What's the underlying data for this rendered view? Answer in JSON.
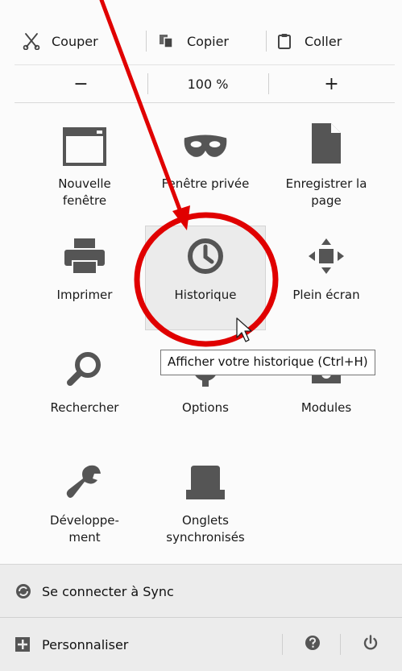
{
  "edit": {
    "cut_label": "Couper",
    "copy_label": "Copier",
    "paste_label": "Coller"
  },
  "zoom": {
    "minus": "−",
    "level": "100 %",
    "plus": "+"
  },
  "tiles": {
    "new_window": "Nouvelle\nfenêtre",
    "private_window": "Fenêtre privée",
    "save_page": "Enregistrer la\npage",
    "print": "Imprimer",
    "history": "Historique",
    "fullscreen": "Plein écran",
    "search": "Rechercher",
    "options": "Options",
    "addons": "Modules",
    "developer": "Développe-\nment",
    "synced_tabs": "Onglets\nsynchronisés"
  },
  "tooltip": "Afficher votre historique (Ctrl+H)",
  "footer": {
    "sync_label": "Se connecter à Sync",
    "customize_label": "Personnaliser"
  },
  "icons": {
    "cut": "scissors-icon",
    "copy": "copy-icon",
    "paste": "clipboard-icon",
    "new_window": "window-icon",
    "private_window": "mask-icon",
    "save_page": "page-icon",
    "print": "printer-icon",
    "history": "clock-icon",
    "fullscreen": "fullscreen-icon",
    "search": "magnifier-icon",
    "options": "gear-icon",
    "addons": "puzzle-icon",
    "developer": "wrench-icon",
    "synced_tabs": "synced-tabs-icon",
    "sync": "sync-icon",
    "customize": "plus-square-icon",
    "help": "help-icon",
    "quit": "power-icon"
  },
  "colors": {
    "icon": "#555555",
    "annotation": "#e00000",
    "hover_tile": "#ebebeb",
    "footer_bg": "#ececec"
  }
}
